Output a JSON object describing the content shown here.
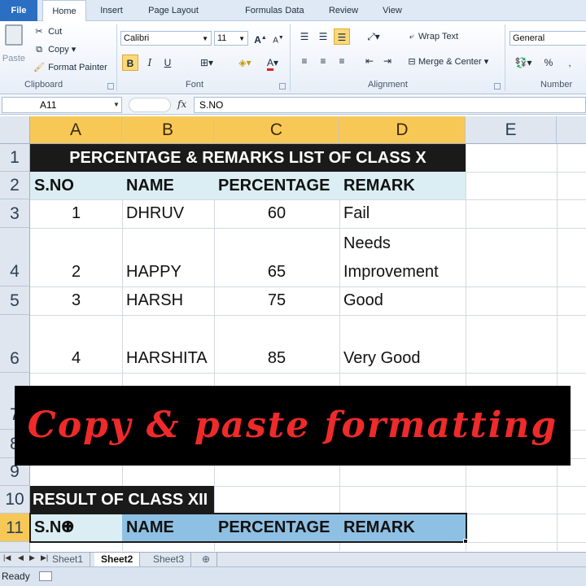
{
  "ribbon": {
    "tabs": [
      "File",
      "Home",
      "Insert",
      "Page Layout",
      "Formulas",
      "Data",
      "Review",
      "View"
    ],
    "active_tab": "Home",
    "clipboard": {
      "paste": "Paste",
      "cut": "Cut",
      "copy": "Copy",
      "format_painter": "Format Painter",
      "label": "Clipboard"
    },
    "font": {
      "name": "Calibri",
      "size": "11",
      "bold": "B",
      "italic": "I",
      "underline": "U",
      "label": "Font"
    },
    "alignment": {
      "wrap": "Wrap Text",
      "merge": "Merge & Center",
      "label": "Alignment"
    },
    "number": {
      "format": "General",
      "percent": "%",
      "label": "Number"
    }
  },
  "formula_bar": {
    "name_box": "A11",
    "fx": "fx",
    "content": "S.NO"
  },
  "grid": {
    "columns": [
      "A",
      "B",
      "C",
      "D",
      "E"
    ],
    "rows": [
      "1",
      "2",
      "3",
      "4",
      "5",
      "6",
      "7",
      "8",
      "9",
      "10",
      "11"
    ],
    "title": "PERCENTAGE & REMARKS LIST OF CLASS X",
    "headers": [
      "S.NO",
      "NAME",
      "PERCENTAGE",
      "REMARK"
    ],
    "data": [
      {
        "sno": "1",
        "name": "DHRUV",
        "pct": "60",
        "remark": "Fail"
      },
      {
        "sno": "2",
        "name": "HAPPY",
        "pct": "65",
        "remark_line1": "Needs",
        "remark_line2": "Improvement"
      },
      {
        "sno": "3",
        "name": "HARSH",
        "pct": "75",
        "remark": "Good"
      },
      {
        "sno": "4",
        "name": "HARSHITA",
        "pct": "85",
        "remark": "Very Good"
      }
    ],
    "result_title": "RESULT OF CLASS XII",
    "result_headers": [
      "S.NO",
      "NAME",
      "PERCENTAGE",
      "REMARK"
    ]
  },
  "sheets": {
    "tabs": [
      "Sheet1",
      "Sheet2",
      "Sheet3"
    ],
    "active": "Sheet2"
  },
  "status": {
    "text": "Ready"
  },
  "overlay": {
    "text": "Copy & paste formatting"
  },
  "colors": {
    "title_bg": "#1a1a1a",
    "title_fg": "#ffffff",
    "header_bg": "#daeef3",
    "selected_header": "#f8c857",
    "paste_target_bg": "#8ec0e4",
    "overlay_text": "#ef2a2a"
  }
}
